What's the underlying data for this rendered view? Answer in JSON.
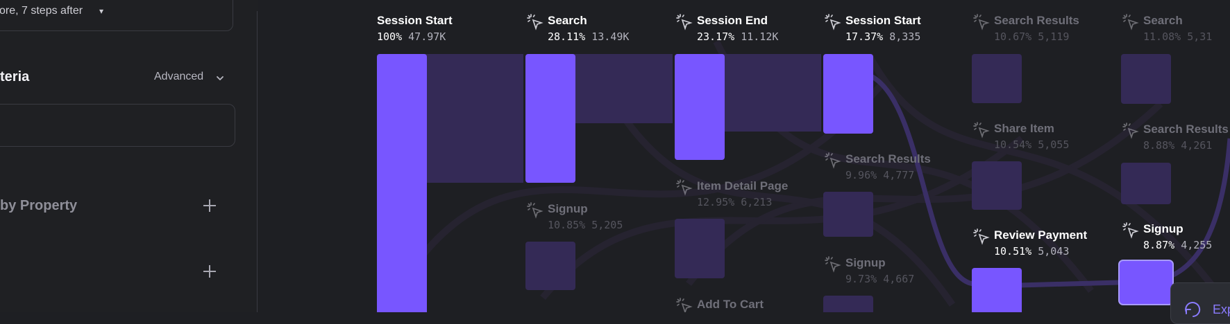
{
  "sidebar": {
    "steps_text": "ore, 7 steps after",
    "criteria_title": "teria",
    "advanced_label": "Advanced",
    "by_property_label": "by Property"
  },
  "colors": {
    "accent": "#7856ff",
    "flow": "#342a56",
    "panel_bg": "#1f2023"
  },
  "flow": {
    "columns": [
      {
        "nodes": [
          {
            "name": "Session Start",
            "pct": "100%",
            "count": "47.97K",
            "highlighted": true,
            "icon": "none"
          }
        ]
      },
      {
        "nodes": [
          {
            "name": "Search",
            "pct": "28.11%",
            "count": "13.49K",
            "highlighted": true,
            "icon": "cursor-click-icon"
          },
          {
            "name": "Signup",
            "pct": "10.85%",
            "count": "5,205",
            "highlighted": false,
            "icon": "cursor-click-icon"
          }
        ]
      },
      {
        "nodes": [
          {
            "name": "Session End",
            "pct": "23.17%",
            "count": "11.12K",
            "highlighted": true,
            "icon": "cursor-click-icon"
          },
          {
            "name": "Item Detail Page",
            "pct": "12.95%",
            "count": "6,213",
            "highlighted": false,
            "icon": "cursor-click-icon"
          },
          {
            "name": "Add To Cart",
            "pct": "",
            "count": "",
            "highlighted": false,
            "icon": "cursor-click-icon"
          }
        ]
      },
      {
        "nodes": [
          {
            "name": "Session Start",
            "pct": "17.37%",
            "count": "8,335",
            "highlighted": true,
            "icon": "cursor-click-icon"
          },
          {
            "name": "Search Results",
            "pct": "9.96%",
            "count": "4,777",
            "highlighted": false,
            "icon": "cursor-click-icon"
          },
          {
            "name": "Signup",
            "pct": "9.73%",
            "count": "4,667",
            "highlighted": false,
            "icon": "cursor-click-icon"
          }
        ]
      },
      {
        "nodes": [
          {
            "name": "Search Results",
            "pct": "10.67%",
            "count": "5,119",
            "highlighted": false,
            "icon": "cursor-click-icon"
          },
          {
            "name": "Share Item",
            "pct": "10.54%",
            "count": "5,055",
            "highlighted": false,
            "icon": "cursor-click-icon"
          },
          {
            "name": "Review Payment",
            "pct": "10.51%",
            "count": "5,043",
            "highlighted": true,
            "icon": "cursor-click-icon"
          }
        ]
      },
      {
        "nodes": [
          {
            "name": "Search",
            "pct": "11.08%",
            "count": "5,31",
            "highlighted": false,
            "icon": "cursor-click-icon"
          },
          {
            "name": "Search Results",
            "pct": "8.88%",
            "count": "4,261",
            "highlighted": false,
            "icon": "cursor-click-icon"
          },
          {
            "name": "Signup",
            "pct": "8.87%",
            "count": "4,255",
            "highlighted": true,
            "icon": "cursor-click-icon"
          }
        ]
      }
    ]
  },
  "explore_button": {
    "label": "Exp",
    "icon": "explore-icon"
  }
}
